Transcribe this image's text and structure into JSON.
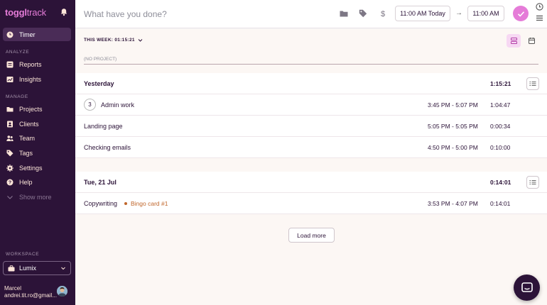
{
  "sidebar": {
    "logo_bold": "toggl",
    "logo_light": "track",
    "items": [
      {
        "label": "Timer",
        "icon": "clock-icon",
        "active": true
      },
      {
        "label": "Reports",
        "icon": "reports-icon"
      },
      {
        "label": "Insights",
        "icon": "insights-icon"
      },
      {
        "label": "Projects",
        "icon": "folder-icon"
      },
      {
        "label": "Clients",
        "icon": "client-icon"
      },
      {
        "label": "Team",
        "icon": "team-icon"
      },
      {
        "label": "Tags",
        "icon": "tag-icon"
      },
      {
        "label": "Settings",
        "icon": "gear-icon"
      },
      {
        "label": "Help",
        "icon": "help-icon"
      },
      {
        "label": "Show more",
        "icon": "chevron-down-icon"
      }
    ],
    "section_analyze": "ANALYZE",
    "section_manage": "MANAGE",
    "section_workspace": "WORKSPACE",
    "workspace": "Lumix",
    "user_name": "Marcel",
    "user_email": "andrei.tit.ro@gmail..."
  },
  "topbar": {
    "description_placeholder": "What have you done?",
    "start_time": "11:00 AM Today",
    "end_time": "11:00 AM",
    "arrow": "→"
  },
  "main": {
    "week_total": "THIS WEEK: 01:15:21",
    "no_project": "(NO PROJECT)",
    "groups": [
      {
        "date": "Yesterday",
        "total": "1:15:21",
        "entries": [
          {
            "count": "3",
            "title": "Admin work",
            "project": "",
            "range": "3:45 PM - 5:07 PM",
            "duration": "1:04:47"
          },
          {
            "title": "Landing page",
            "project": "",
            "range": "5:05 PM - 5:05 PM",
            "duration": "0:00:34"
          },
          {
            "title": "Checking emails",
            "project": "",
            "range": "4:50 PM - 5:00 PM",
            "duration": "0:10:00"
          }
        ]
      },
      {
        "date": "Tue, 21 Jul",
        "total": "0:14:01",
        "entries": [
          {
            "title": "Copywriting",
            "project": "Bingo card #1",
            "range": "3:53 PM - 4:07 PM",
            "duration": "0:14:01"
          }
        ]
      }
    ],
    "load_more": "Load more"
  },
  "colors": {
    "sidebar_bg": "#2c1338",
    "accent": "#e57cd8",
    "project_color": "#c0662b"
  }
}
